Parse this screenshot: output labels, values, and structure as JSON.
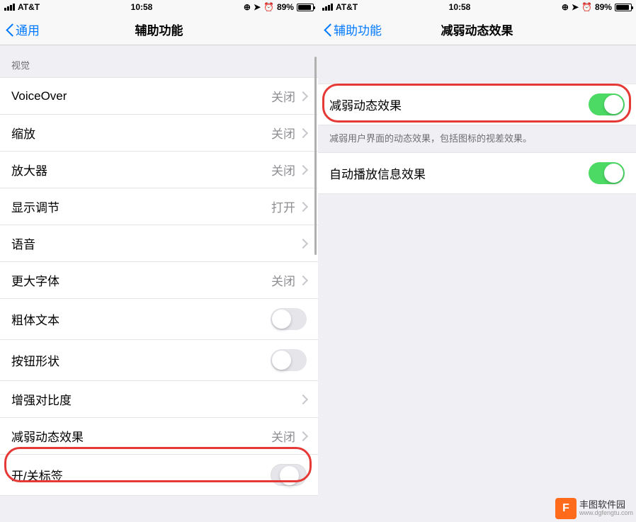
{
  "statusBar": {
    "carrier": "AT&T",
    "time": "10:58",
    "battery": "89%"
  },
  "leftScreen": {
    "backLabel": "通用",
    "title": "辅助功能",
    "sectionHeader": "视觉",
    "items": [
      {
        "label": "VoiceOver",
        "value": "关闭",
        "type": "nav"
      },
      {
        "label": "缩放",
        "value": "关闭",
        "type": "nav"
      },
      {
        "label": "放大器",
        "value": "关闭",
        "type": "nav"
      },
      {
        "label": "显示调节",
        "value": "打开",
        "type": "nav"
      },
      {
        "label": "语音",
        "value": "",
        "type": "nav"
      },
      {
        "label": "更大字体",
        "value": "关闭",
        "type": "nav"
      },
      {
        "label": "粗体文本",
        "value": "",
        "type": "toggle",
        "on": false
      },
      {
        "label": "按钮形状",
        "value": "",
        "type": "toggle",
        "on": false
      },
      {
        "label": "增强对比度",
        "value": "",
        "type": "nav"
      },
      {
        "label": "减弱动态效果",
        "value": "关闭",
        "type": "nav"
      },
      {
        "label": "开/关标签",
        "value": "",
        "type": "toggle",
        "on": false
      }
    ]
  },
  "rightScreen": {
    "backLabel": "辅助功能",
    "title": "减弱动态效果",
    "items": [
      {
        "label": "减弱动态效果",
        "type": "toggle",
        "on": true
      }
    ],
    "footerText": "减弱用户界面的动态效果，包括图标的视差效果。",
    "items2": [
      {
        "label": "自动播放信息效果",
        "type": "toggle",
        "on": true
      }
    ]
  },
  "watermark": {
    "name": "丰图软件园",
    "url": "www.dgfengtu.com"
  }
}
